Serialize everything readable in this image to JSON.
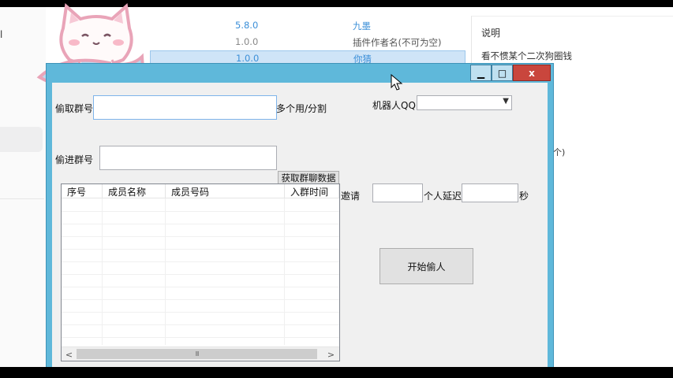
{
  "background_app": {
    "left_fragment": "l",
    "plugin_rows": [
      {
        "version": "5.8.0",
        "author": "九墨"
      },
      {
        "version": "1.0.0",
        "author": "插件作者名(不可为空)"
      },
      {
        "version": "1.0.0",
        "author": "你猜"
      }
    ],
    "description_title": "说明",
    "description_text": "看不惯某个二次狗圈钱",
    "description_fragment": "个)"
  },
  "window": {
    "minimize_symbol": "▁",
    "maximize_symbol": "□",
    "close_symbol": "x",
    "steal_group_label": "偷取群号",
    "steal_group_value": "",
    "multi_hint": "多个用/分割",
    "robot_qq_label": "机器人QQ",
    "robot_qq_value": "",
    "target_group_label": "偷进群号",
    "target_group_value": "",
    "fetch_button": "获取群聊数据",
    "invite_label": "邀请",
    "invite_value": "",
    "per_person_delay_label": "个人延迟",
    "delay_value": "",
    "seconds_label": "秒",
    "start_button": "开始偷人",
    "table": {
      "columns": [
        "序号",
        "成员名称",
        "成员号码",
        "入群时间"
      ],
      "rows": []
    },
    "scroll_left": "<",
    "scroll_right": ">",
    "scroll_thumb_grip": "III"
  },
  "colors": {
    "window_frame": "#5fb8da",
    "close_button": "#c9463d",
    "selected_row": "#cfe4f7",
    "link_blue": "#3b8fd8"
  },
  "icons": {
    "sticker": "cat-holding-fish-sticker",
    "combo_arrow": "chevron-down-icon"
  }
}
